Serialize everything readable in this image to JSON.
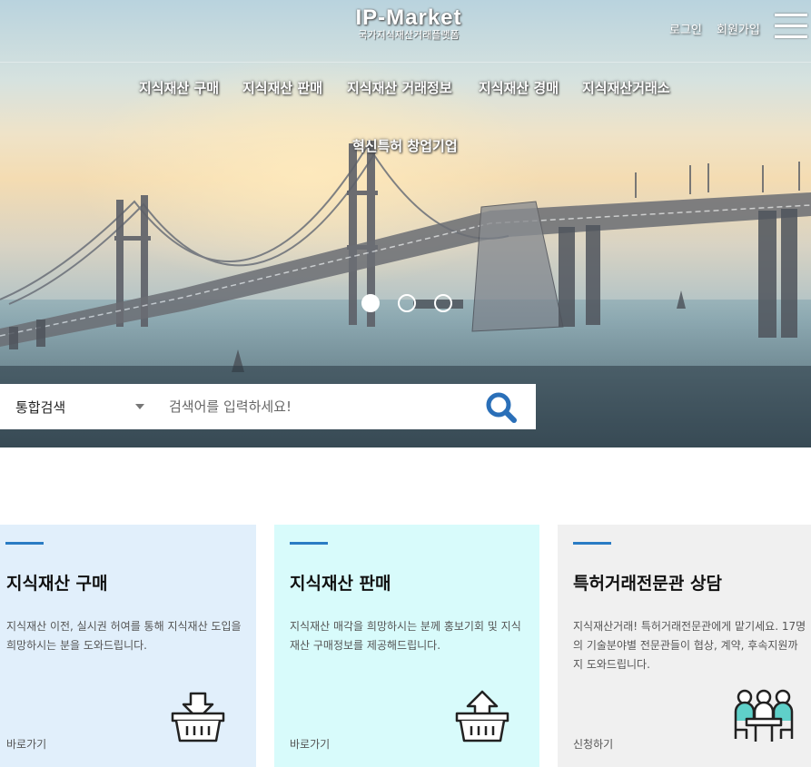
{
  "header": {
    "logo_title": "IP-Market",
    "logo_subtitle": "국가지식재산거래플랫폼",
    "login_label": "로그인",
    "signup_label": "회원가입",
    "menu_icon": "hamburger-menu-icon"
  },
  "nav": {
    "items": [
      {
        "label": "지식재산 구매"
      },
      {
        "label": "지식재산 판매"
      },
      {
        "label": "지식재산 거래정보"
      },
      {
        "label": "지식재산 경매"
      },
      {
        "label": "지식재산거래소"
      },
      {
        "label": "혁신특허 창업기업"
      }
    ]
  },
  "slider": {
    "slide_count": 3,
    "active_index": 0
  },
  "search": {
    "category_selected": "통합검색",
    "placeholder": "검색어를 입력하세요!",
    "button_icon": "search-icon"
  },
  "cards": [
    {
      "title": "지식재산 구매",
      "description": "지식재산 이전, 실시권 허여를 통해 지식재산 도입을 희망하시는 분을 도와드립니다.",
      "link_label": "바로가기",
      "icon": "basket-download-icon"
    },
    {
      "title": "지식재산 판매",
      "description": "지식재산 매각을 희망하시는 분께 홍보기회 및 지식재산 구매정보를 제공해드립니다.",
      "link_label": "바로가기",
      "icon": "basket-upload-icon"
    },
    {
      "title": "특허거래전문관 상담",
      "description": "지식재산거래! 특허거래전문관에게 맡기세요. 17명의 기술분야별 전문관들이 협상, 계약, 후속지원까지 도와드립니다.",
      "link_label": "신청하기",
      "icon": "consultation-people-icon"
    }
  ],
  "colors": {
    "accent": "#2a7cc4",
    "search_icon": "#2a6fb8",
    "card1_bg": "#e1effb",
    "card2_bg": "#d8fbfb",
    "card3_bg": "#f0f0f0",
    "consult_icon_fill": "#5fd0c9"
  }
}
